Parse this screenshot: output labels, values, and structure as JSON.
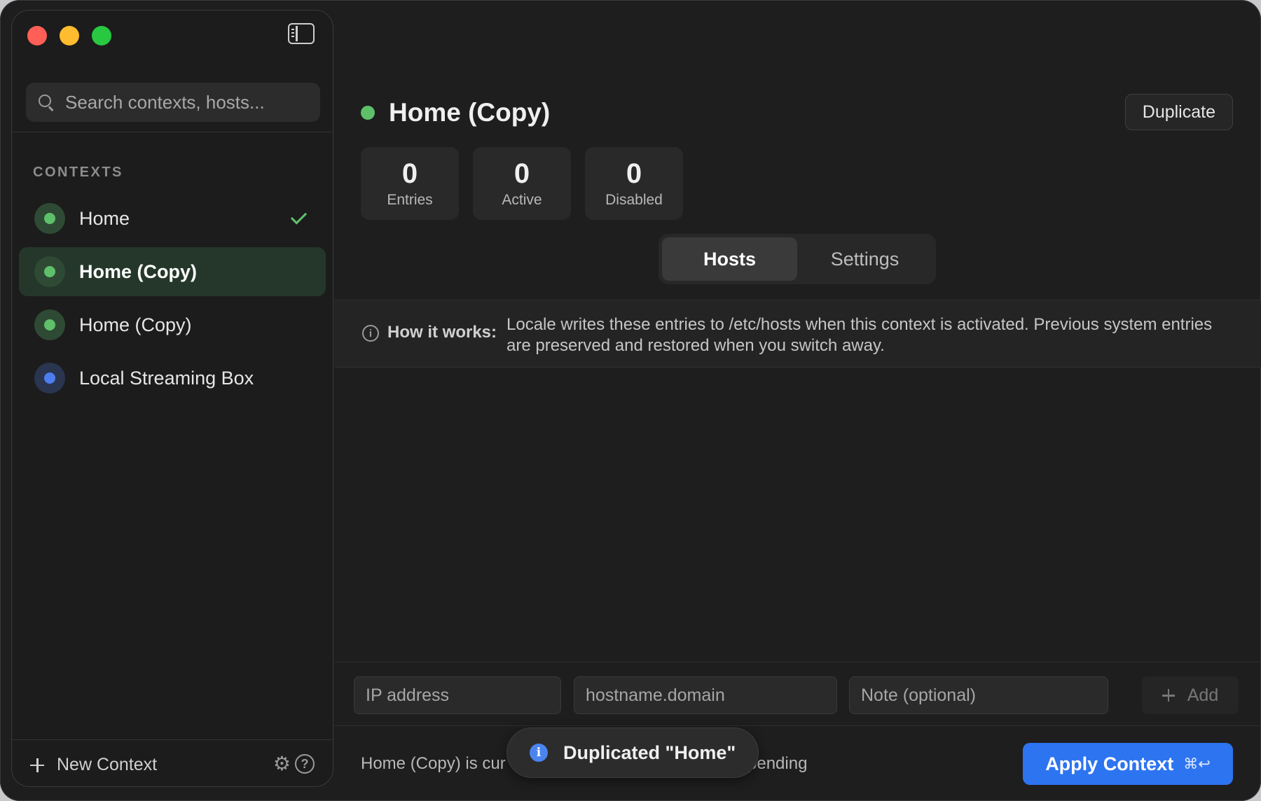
{
  "sidebar": {
    "search_placeholder": "Search contexts, hosts...",
    "section_title": "CONTEXTS",
    "items": [
      {
        "label": "Home",
        "dot_color": "#5ec16a",
        "ring_color": "#2f4a34",
        "active_check": true,
        "selected": false
      },
      {
        "label": "Home (Copy)",
        "dot_color": "#5ec16a",
        "ring_color": "#2f4a34",
        "active_check": false,
        "selected": true
      },
      {
        "label": "Home (Copy)",
        "dot_color": "#5ec16a",
        "ring_color": "#2f4a34",
        "active_check": false,
        "selected": false
      },
      {
        "label": "Local Streaming Box",
        "dot_color": "#4d7ef0",
        "ring_color": "#2a3550",
        "active_check": false,
        "selected": false
      }
    ],
    "new_context_label": "New Context"
  },
  "main": {
    "title": "Home (Copy)",
    "status_color": "#5ec16a",
    "duplicate_label": "Duplicate",
    "stats": [
      {
        "value": "0",
        "label": "Entries"
      },
      {
        "value": "0",
        "label": "Active"
      },
      {
        "value": "0",
        "label": "Disabled"
      }
    ],
    "tabs": [
      {
        "label": "Hosts",
        "active": true
      },
      {
        "label": "Settings",
        "active": false
      }
    ],
    "info": {
      "heading": "How it works:",
      "text": "Locale writes these entries to /etc/hosts when this context is activated. Previous system entries are preserved and restored when you switch away."
    },
    "entry_form": {
      "ip_placeholder": "IP address",
      "host_placeholder": "hostname.domain",
      "note_placeholder": "Note (optional)",
      "add_label": "Add"
    },
    "status_left": "Home (Copy) is cur",
    "status_right": "pending",
    "toast": "Duplicated \"Home\"",
    "apply_label": "Apply Context",
    "apply_shortcut": "⌘↩",
    "accent_color": "#2d74f0"
  }
}
